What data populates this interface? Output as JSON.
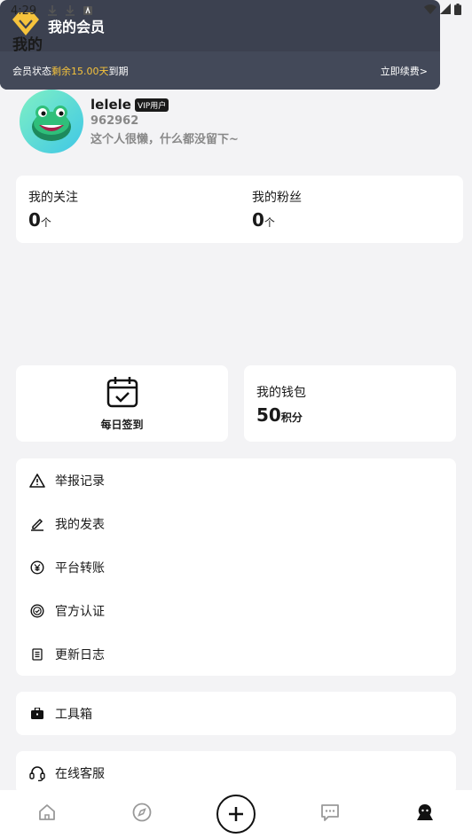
{
  "status_bar": {
    "time": "4:29"
  },
  "header": {
    "title": "我的"
  },
  "profile": {
    "name": "lelele",
    "badge": "VIP用户",
    "id": "962962",
    "bio": "这个人很懒，什么都没留下~"
  },
  "follow": {
    "following_label": "我的关注",
    "following_count": "0",
    "following_unit": "个",
    "fans_label": "我的粉丝",
    "fans_count": "0",
    "fans_unit": "个"
  },
  "membership": {
    "title": "我的会员",
    "status_prefix": "会员状态",
    "status_highlight": "剩余15.00天",
    "status_suffix": "到期",
    "renew_label": "立即续费>"
  },
  "checkin": {
    "label": "每日签到"
  },
  "wallet": {
    "label": "我的钱包",
    "points": "50",
    "points_unit": "积分"
  },
  "menu": {
    "items": [
      {
        "label": "举报记录",
        "icon": "warning-icon"
      },
      {
        "label": "我的发表",
        "icon": "pen-icon"
      },
      {
        "label": "平台转账",
        "icon": "yen-icon"
      },
      {
        "label": "官方认证",
        "icon": "verified-icon"
      },
      {
        "label": "更新日志",
        "icon": "list-icon"
      }
    ]
  },
  "tools": {
    "label": "工具箱",
    "icon": "toolbox-icon"
  },
  "service": {
    "label": "在线客服",
    "icon": "headset-icon"
  },
  "tabbar": {
    "tabs": [
      {
        "icon": "home-icon"
      },
      {
        "icon": "compass-icon"
      },
      {
        "icon": "plus-icon"
      },
      {
        "icon": "chat-icon"
      },
      {
        "icon": "profile-icon"
      }
    ]
  },
  "colors": {
    "accent_gold": "#f6c33c",
    "member_bg": "#3c4150",
    "page_bg": "#f3f3f5"
  }
}
